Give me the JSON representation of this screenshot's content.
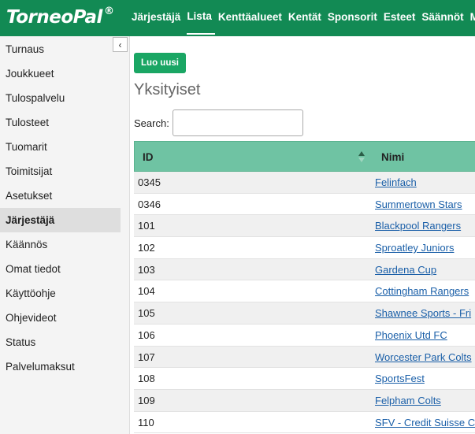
{
  "brand": {
    "name": "TorneoPal",
    "mark": "®"
  },
  "nav": [
    "Järjestäjä",
    "Lista",
    "Kenttäalueet",
    "Kentät",
    "Sponsorit",
    "Esteet",
    "Säännöt",
    "Mas"
  ],
  "nav_active": "Lista",
  "sidebar": {
    "collapse_icon": "‹",
    "items": [
      "Turnaus",
      "Joukkueet",
      "Tulospalvelu",
      "Tulosteet",
      "Tuomarit",
      "Toimitsijat",
      "Asetukset",
      "Järjestäjä",
      "Käännös",
      "Omat tiedot",
      "Käyttöohje",
      "Ohjevideot",
      "Status",
      "Palvelumaksut"
    ],
    "active": "Järjestäjä"
  },
  "main": {
    "new_button": "Luo uusi",
    "title": "Yksityiset",
    "search_label": "Search:",
    "search_value": ""
  },
  "table": {
    "headers": {
      "id": "ID",
      "name": "Nimi"
    },
    "rows": [
      {
        "id": "0345",
        "name": "Felinfach"
      },
      {
        "id": "0346",
        "name": "Summertown Stars"
      },
      {
        "id": "101",
        "name": "Blackpool Rangers"
      },
      {
        "id": "102",
        "name": "Sproatley Juniors"
      },
      {
        "id": "103",
        "name": "Gardena Cup"
      },
      {
        "id": "104",
        "name": "Cottingham Rangers"
      },
      {
        "id": "105",
        "name": "Shawnee Sports - Fri"
      },
      {
        "id": "106",
        "name": "Phoenix Utd FC"
      },
      {
        "id": "107",
        "name": "Worcester Park Colts"
      },
      {
        "id": "108",
        "name": "SportsFest"
      },
      {
        "id": "109",
        "name": "Felpham Colts"
      },
      {
        "id": "110",
        "name": "SFV - Credit Suisse C"
      }
    ]
  },
  "colors": {
    "topbar": "#128a54",
    "header_row": "#6fc3a3",
    "button": "#1aa664",
    "link": "#1a5fa8"
  }
}
